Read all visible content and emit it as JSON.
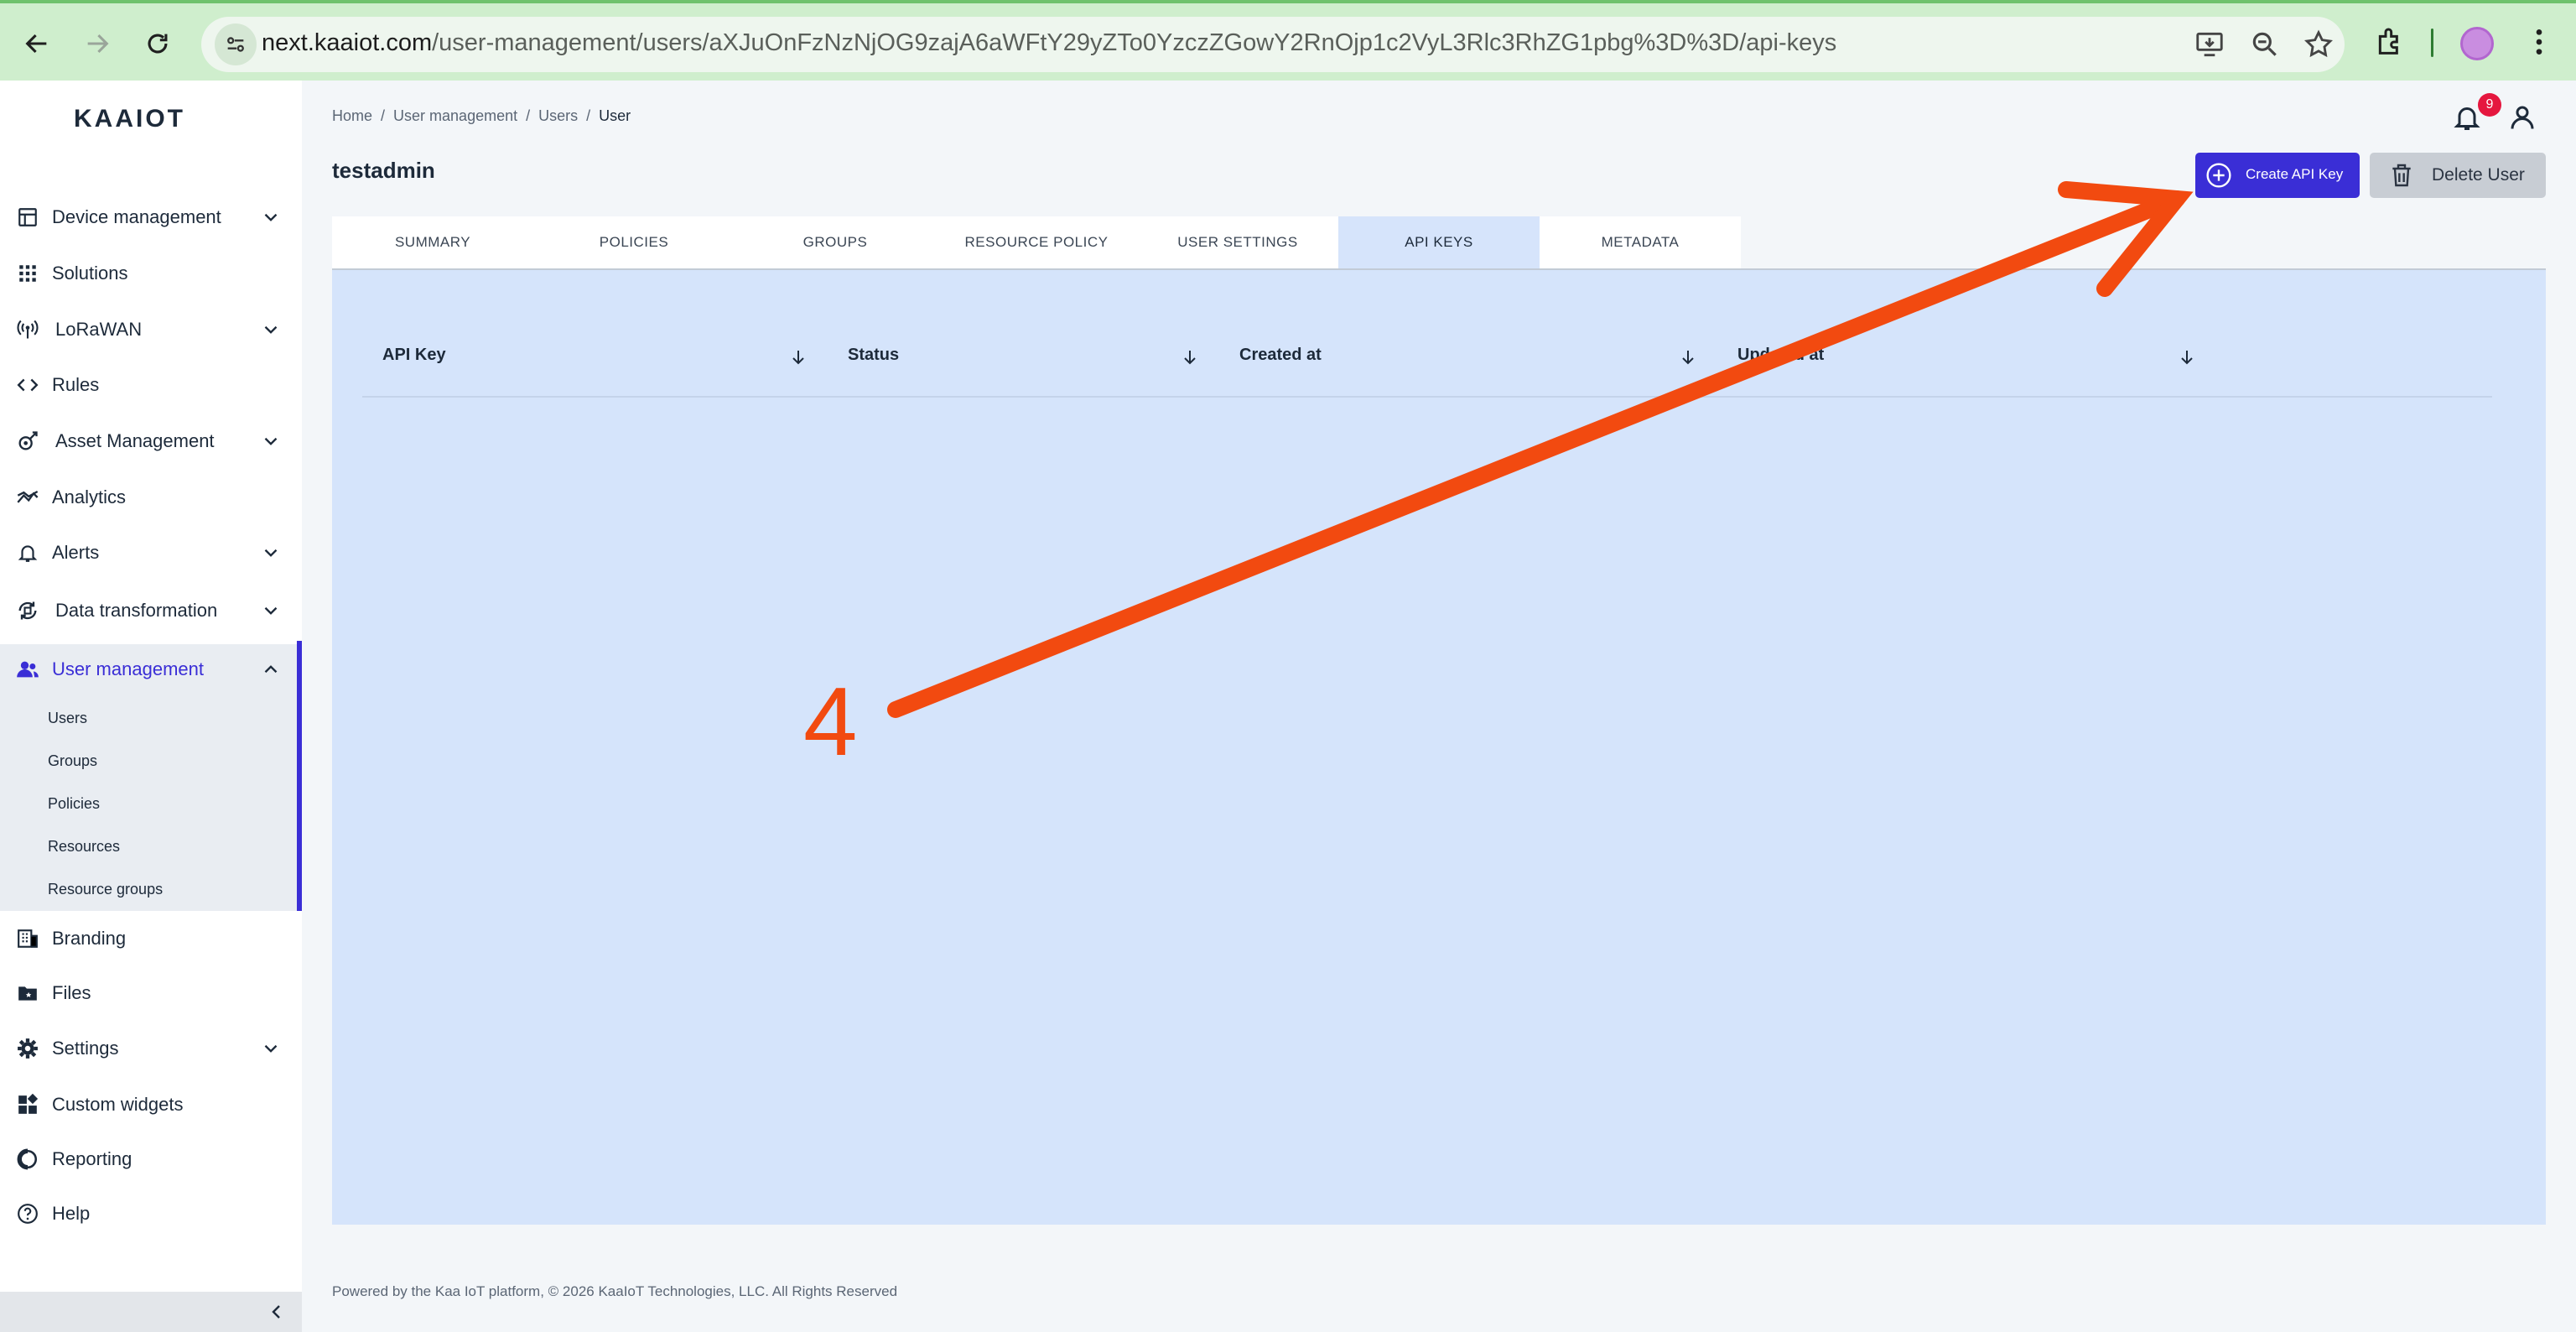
{
  "browser": {
    "url_domain": "next.kaaiot.com",
    "url_path": "/user-management/users/aXJuOnFzNzNjOG9zajA6aWFtY29yZTo0YzczZGowY2RnOjp1c2VyL3Rlc3RhZG1pbg%3D%3D/api-keys"
  },
  "sidebar": {
    "logo": "KAAIOT",
    "items": [
      {
        "label": "Device management",
        "icon": "dashboard-icon",
        "chevron": "down"
      },
      {
        "label": "Solutions",
        "icon": "grid-icon",
        "chevron": ""
      },
      {
        "label": "LoRaWAN",
        "icon": "antenna-icon",
        "chevron": "down"
      },
      {
        "label": "Rules",
        "icon": "code-icon",
        "chevron": ""
      },
      {
        "label": "Asset Management",
        "icon": "asset-icon",
        "chevron": "down"
      },
      {
        "label": "Analytics",
        "icon": "analytics-icon",
        "chevron": ""
      },
      {
        "label": "Alerts",
        "icon": "bell-icon",
        "chevron": "down"
      },
      {
        "label": "Data transformation",
        "icon": "transform-icon",
        "chevron": "down"
      },
      {
        "label": "User management",
        "icon": "users-icon",
        "chevron": "up"
      },
      {
        "label": "Branding",
        "icon": "branding-icon",
        "chevron": ""
      },
      {
        "label": "Files",
        "icon": "folder-icon",
        "chevron": ""
      },
      {
        "label": "Settings",
        "icon": "gear-icon",
        "chevron": "down"
      },
      {
        "label": "Custom widgets",
        "icon": "widgets-icon",
        "chevron": ""
      },
      {
        "label": "Reporting",
        "icon": "reporting-icon",
        "chevron": ""
      },
      {
        "label": "Help",
        "icon": "help-icon",
        "chevron": ""
      }
    ],
    "sub_items": [
      "Users",
      "Groups",
      "Policies",
      "Resources",
      "Resource groups"
    ]
  },
  "header": {
    "breadcrumb": [
      "Home",
      "User management",
      "Users",
      "User"
    ],
    "title": "testadmin",
    "notification_count": "9",
    "create_button": "Create API Key",
    "delete_button": "Delete User"
  },
  "tabs": [
    "SUMMARY",
    "POLICIES",
    "GROUPS",
    "RESOURCE POLICY",
    "USER SETTINGS",
    "API KEYS",
    "METADATA"
  ],
  "active_tab": "API KEYS",
  "table": {
    "columns": [
      "API Key",
      "Status",
      "Created at",
      "Updated at"
    ]
  },
  "annotation": {
    "step": "4",
    "color": "#f24a10"
  },
  "footer": "Powered by the Kaa IoT platform, © 2026 KaaIoT Technologies, LLC. All Rights Reserved",
  "colors": {
    "accent": "#3a2ed6",
    "panel": "#d5e4fb",
    "badge": "#e5173f"
  }
}
